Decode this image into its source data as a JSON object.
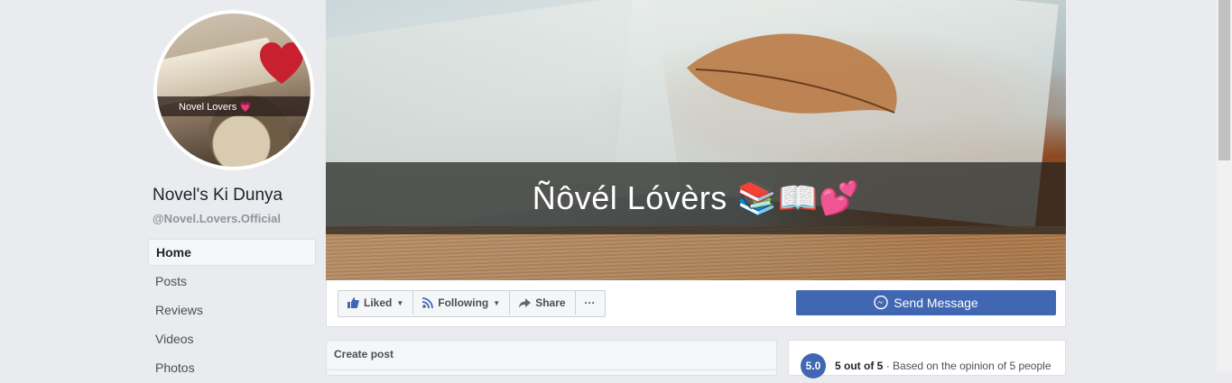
{
  "profile": {
    "image_label": "Novel Lovers 💗",
    "page_name": "Novel's Ki Dunya",
    "handle": "@Novel.Lovers.Official"
  },
  "sidebar": {
    "items": [
      {
        "label": "Home",
        "active": true
      },
      {
        "label": "Posts",
        "active": false
      },
      {
        "label": "Reviews",
        "active": false
      },
      {
        "label": "Videos",
        "active": false
      },
      {
        "label": "Photos",
        "active": false
      }
    ]
  },
  "cover": {
    "title": "Ñôvél Lóvèrs 📚📖💕"
  },
  "actions": {
    "liked_label": "Liked",
    "following_label": "Following",
    "share_label": "Share",
    "more_label": "···",
    "send_message_label": "Send Message"
  },
  "create_post": {
    "title": "Create post"
  },
  "rating": {
    "score": "5.0",
    "summary": "5 out of 5",
    "detail": "· Based on the opinion of 5 people"
  },
  "colors": {
    "brand": "#4267b2",
    "page_bg": "#e9ebee"
  }
}
